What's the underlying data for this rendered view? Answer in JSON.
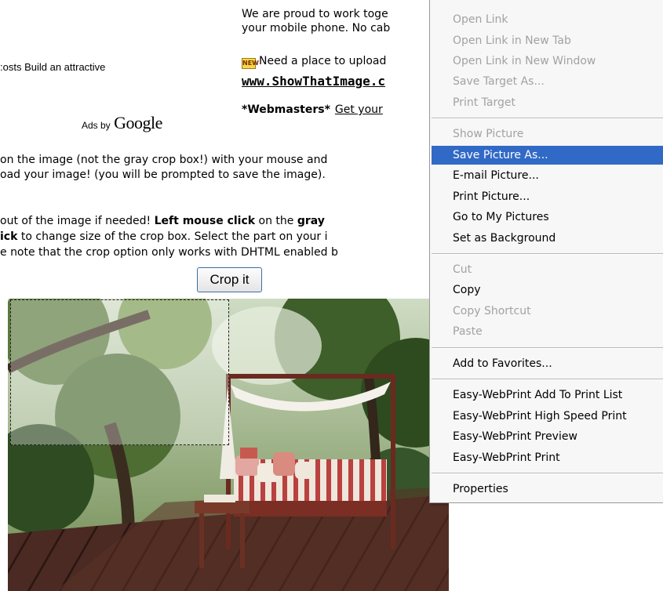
{
  "ad": {
    "fragment": ":osts Build an attractive",
    "ads_by": "Ads by",
    "google": "Google"
  },
  "header": {
    "proud_line1": "We are proud to work toge",
    "proud_line2": "your mobile phone. No cab",
    "new_icon": "NEW",
    "upload_line1": "Need a place to upload",
    "upload_link": "www.ShowThatImage.c",
    "webmasters_bold": "*Webmasters*",
    "webmasters_link": "Get your"
  },
  "instructions": {
    "line1": "on the image (not the gray crop box!) with your mouse and",
    "line2": "oad your image! (you will be prompted to save the image).",
    "line3_a": "out of the image if needed! ",
    "line3_b": "Left mouse click",
    "line3_c": " on the ",
    "line3_d": "gray",
    "line4_a": "ick",
    "line4_b": " to change size of the crop box. Select the part on your i",
    "line5": "e note that the crop option only works with DHTML enabled b"
  },
  "crop_button": "Crop it",
  "context_menu": {
    "items": [
      {
        "label": "Open Link",
        "enabled": false
      },
      {
        "label": "Open Link in New Tab",
        "enabled": false
      },
      {
        "label": "Open Link in New Window",
        "enabled": false
      },
      {
        "label": "Save Target As...",
        "enabled": false
      },
      {
        "label": "Print Target",
        "enabled": false
      },
      {
        "label": "Show Picture",
        "enabled": false
      },
      {
        "label": "Save Picture As...",
        "enabled": true,
        "selected": true
      },
      {
        "label": "E-mail Picture...",
        "enabled": true
      },
      {
        "label": "Print Picture...",
        "enabled": true
      },
      {
        "label": "Go to My Pictures",
        "enabled": true
      },
      {
        "label": "Set as Background",
        "enabled": true
      },
      {
        "label": "Cut",
        "enabled": false
      },
      {
        "label": "Copy",
        "enabled": true
      },
      {
        "label": "Copy Shortcut",
        "enabled": false
      },
      {
        "label": "Paste",
        "enabled": false
      },
      {
        "label": "Add to Favorites...",
        "enabled": true
      },
      {
        "label": "Easy-WebPrint Add To Print List",
        "enabled": true
      },
      {
        "label": "Easy-WebPrint High Speed Print",
        "enabled": true
      },
      {
        "label": "Easy-WebPrint Preview",
        "enabled": true
      },
      {
        "label": "Easy-WebPrint Print",
        "enabled": true
      },
      {
        "label": "Properties",
        "enabled": true
      }
    ]
  },
  "colors": {
    "menu_highlight": "#3169c6",
    "menu_disabled": "#a2a2a2",
    "button_border": "#3c6fa5"
  }
}
